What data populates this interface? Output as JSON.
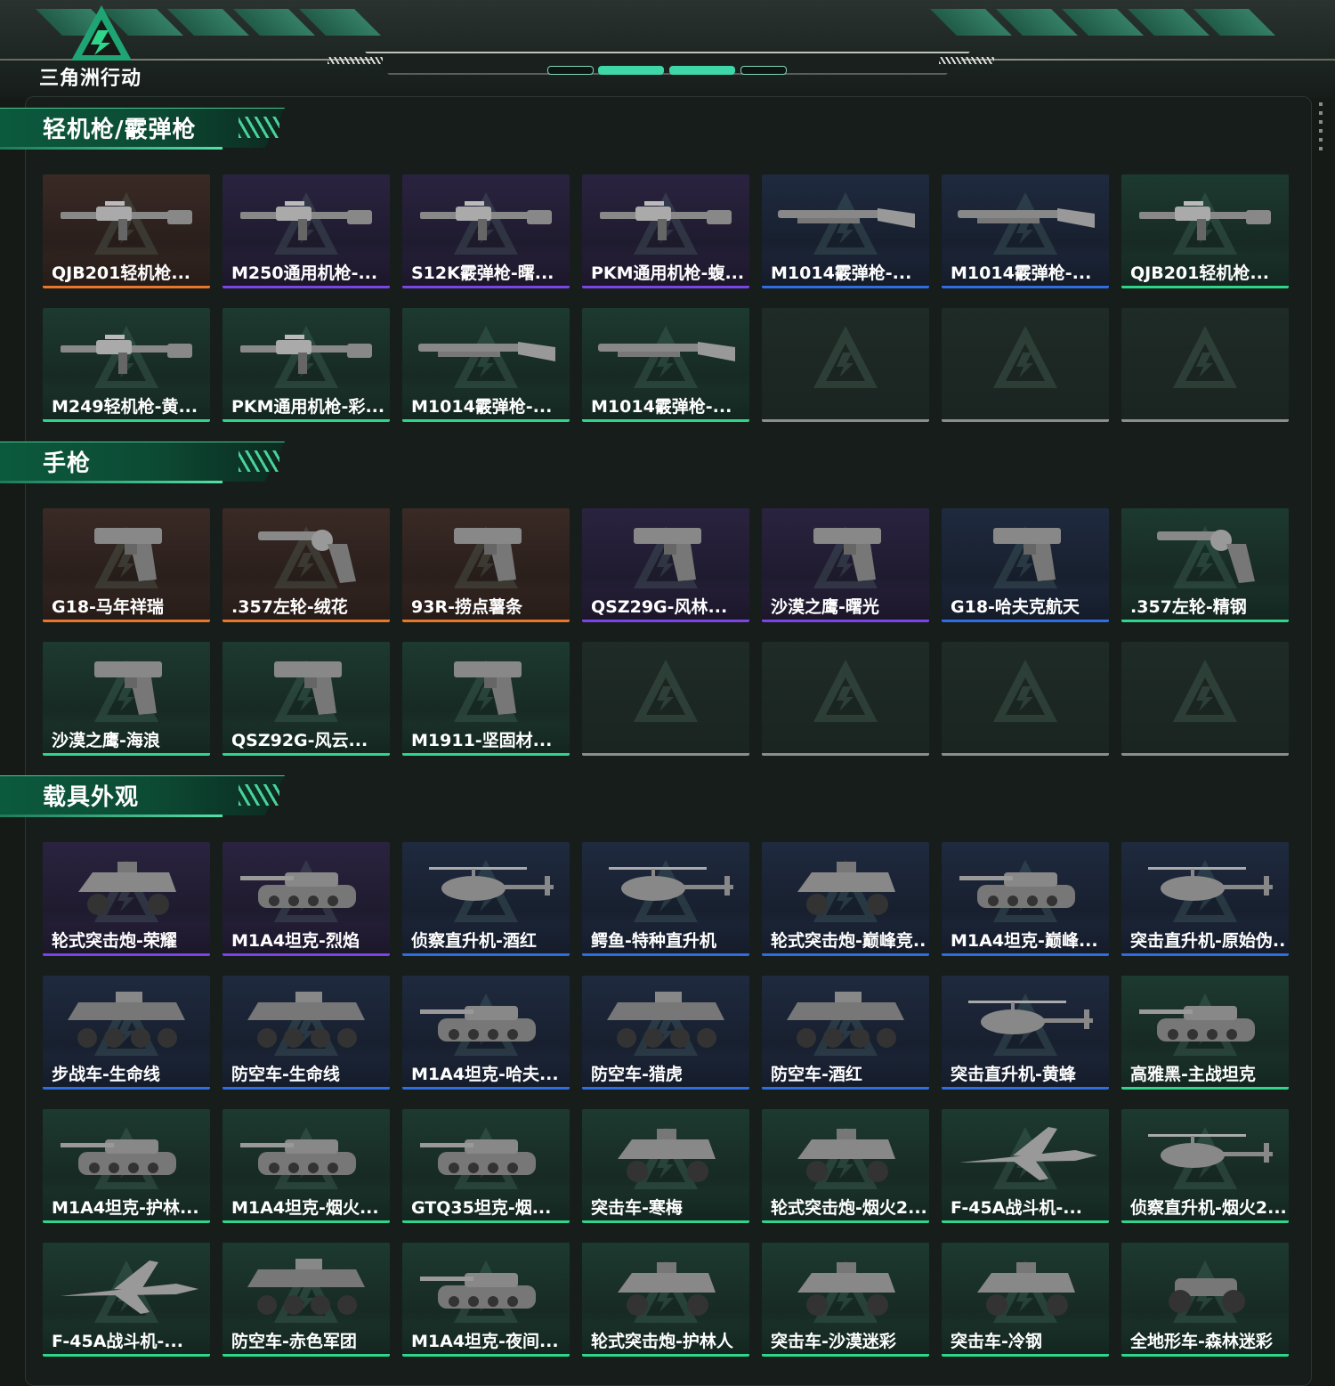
{
  "header": {
    "logo_text": "三角洲行动",
    "colors": {
      "accent": "#3fd6a8",
      "brand_green": "#1f8a64"
    }
  },
  "sections": [
    {
      "title": "轻机枪/霰弹枪",
      "items": [
        {
          "label": "QJB201轻机枪...",
          "rarity": "orange",
          "icon": "rifle-icon"
        },
        {
          "label": "M250通用机枪-...",
          "rarity": "purple",
          "icon": "rifle-icon"
        },
        {
          "label": "S12K霰弹枪-曙...",
          "rarity": "purple",
          "icon": "rifle-icon"
        },
        {
          "label": "PKM通用机枪-蝮...",
          "rarity": "purple",
          "icon": "rifle-icon"
        },
        {
          "label": "M1014霰弹枪-...",
          "rarity": "blue",
          "icon": "shotgun-icon"
        },
        {
          "label": "M1014霰弹枪-...",
          "rarity": "blue",
          "icon": "shotgun-icon"
        },
        {
          "label": "QJB201轻机枪...",
          "rarity": "green",
          "icon": "rifle-icon"
        },
        {
          "label": "M249轻机枪-黄...",
          "rarity": "green",
          "icon": "rifle-icon"
        },
        {
          "label": "PKM通用机枪-彩...",
          "rarity": "green",
          "icon": "rifle-icon"
        },
        {
          "label": "M1014霰弹枪-...",
          "rarity": "green",
          "icon": "shotgun-icon"
        },
        {
          "label": "M1014霰弹枪-...",
          "rarity": "green",
          "icon": "shotgun-icon"
        },
        {
          "label": "",
          "rarity": "empty",
          "icon": "empty-slot-icon"
        },
        {
          "label": "",
          "rarity": "empty",
          "icon": "empty-slot-icon"
        },
        {
          "label": "",
          "rarity": "empty",
          "icon": "empty-slot-icon"
        }
      ]
    },
    {
      "title": "手枪",
      "items": [
        {
          "label": "G18-马年祥瑞",
          "rarity": "orange",
          "icon": "pistol-icon"
        },
        {
          "label": ".357左轮-绒花",
          "rarity": "orange",
          "icon": "revolver-icon"
        },
        {
          "label": "93R-捞点薯条",
          "rarity": "orange",
          "icon": "pistol-icon"
        },
        {
          "label": "QSZ29G-风林...",
          "rarity": "purple",
          "icon": "pistol-icon"
        },
        {
          "label": "沙漠之鹰-曙光",
          "rarity": "purple",
          "icon": "pistol-icon"
        },
        {
          "label": "G18-哈夫克航天",
          "rarity": "blue",
          "icon": "pistol-icon"
        },
        {
          "label": ".357左轮-精钢",
          "rarity": "green",
          "icon": "revolver-icon"
        },
        {
          "label": "沙漠之鹰-海浪",
          "rarity": "green",
          "icon": "pistol-icon"
        },
        {
          "label": "QSZ92G-风云...",
          "rarity": "green",
          "icon": "pistol-icon"
        },
        {
          "label": "M1911-坚固材...",
          "rarity": "green",
          "icon": "pistol-icon"
        },
        {
          "label": "",
          "rarity": "empty",
          "icon": "empty-slot-icon"
        },
        {
          "label": "",
          "rarity": "empty",
          "icon": "empty-slot-icon"
        },
        {
          "label": "",
          "rarity": "empty",
          "icon": "empty-slot-icon"
        },
        {
          "label": "",
          "rarity": "empty",
          "icon": "empty-slot-icon"
        }
      ]
    },
    {
      "title": "载具外观",
      "items": [
        {
          "label": "轮式突击炮-荣耀",
          "rarity": "purple",
          "icon": "armored-car-icon"
        },
        {
          "label": "M1A4坦克-烈焰",
          "rarity": "purple",
          "icon": "tank-icon"
        },
        {
          "label": "侦察直升机-酒红",
          "rarity": "blue",
          "icon": "helicopter-icon"
        },
        {
          "label": "鳄鱼-特种直升机",
          "rarity": "blue",
          "icon": "helicopter-icon"
        },
        {
          "label": "轮式突击炮-巅峰竞...",
          "rarity": "blue",
          "icon": "armored-car-icon"
        },
        {
          "label": "M1A4坦克-巅峰...",
          "rarity": "blue",
          "icon": "tank-icon"
        },
        {
          "label": "突击直升机-原始伪...",
          "rarity": "blue",
          "icon": "helicopter-icon"
        },
        {
          "label": "步战车-生命线",
          "rarity": "blue",
          "icon": "apc-icon"
        },
        {
          "label": "防空车-生命线",
          "rarity": "blue",
          "icon": "apc-icon"
        },
        {
          "label": "M1A4坦克-哈夫...",
          "rarity": "blue",
          "icon": "tank-icon"
        },
        {
          "label": "防空车-猎虎",
          "rarity": "blue",
          "icon": "apc-icon"
        },
        {
          "label": "防空车-酒红",
          "rarity": "blue",
          "icon": "apc-icon"
        },
        {
          "label": "突击直升机-黄蜂",
          "rarity": "blue",
          "icon": "helicopter-icon"
        },
        {
          "label": "高雅黑-主战坦克",
          "rarity": "green",
          "icon": "tank-icon"
        },
        {
          "label": "M1A4坦克-护林...",
          "rarity": "green",
          "icon": "tank-icon"
        },
        {
          "label": "M1A4坦克-烟火...",
          "rarity": "green",
          "icon": "tank-icon"
        },
        {
          "label": "GTQ35坦克-烟...",
          "rarity": "green",
          "icon": "tank-icon"
        },
        {
          "label": "突击车-寒梅",
          "rarity": "green",
          "icon": "armored-car-icon"
        },
        {
          "label": "轮式突击炮-烟火2...",
          "rarity": "green",
          "icon": "armored-car-icon"
        },
        {
          "label": "F-45A战斗机-...",
          "rarity": "green",
          "icon": "jet-icon"
        },
        {
          "label": "侦察直升机-烟火2...",
          "rarity": "green",
          "icon": "helicopter-icon"
        },
        {
          "label": "F-45A战斗机-...",
          "rarity": "green",
          "icon": "jet-icon"
        },
        {
          "label": "防空车-赤色军团",
          "rarity": "green",
          "icon": "apc-icon"
        },
        {
          "label": "M1A4坦克-夜间...",
          "rarity": "green",
          "icon": "tank-icon"
        },
        {
          "label": "轮式突击炮-护林人",
          "rarity": "green",
          "icon": "armored-car-icon"
        },
        {
          "label": "突击车-沙漠迷彩",
          "rarity": "green",
          "icon": "armored-car-icon"
        },
        {
          "label": "突击车-冷钢",
          "rarity": "green",
          "icon": "armored-car-icon"
        },
        {
          "label": "全地形车-森林迷彩",
          "rarity": "green",
          "icon": "atv-icon"
        }
      ]
    }
  ]
}
